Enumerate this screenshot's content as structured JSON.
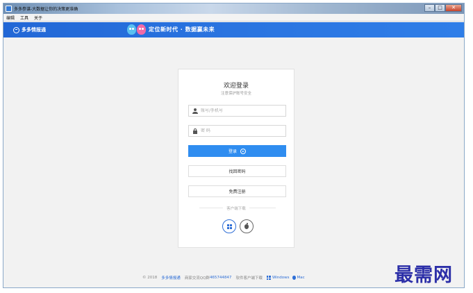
{
  "window": {
    "title": "多多参谋-大数据让你的决策更准确"
  },
  "menu": [
    "编辑",
    "工具",
    "关于"
  ],
  "header": {
    "brand": "多多情报通",
    "slogan": "定位新时代 · 数据赢未来"
  },
  "login": {
    "title": "欢迎登录",
    "subtitle": "注意保护账号安全",
    "username_placeholder": "账号/手机号",
    "password_placeholder": "密 码",
    "login_button": "登录",
    "find_password_button": "找回密码",
    "register_button": "免费注册",
    "download_label": "客户端下载"
  },
  "footer": {
    "copyright": "© 2018",
    "brand": "多多情报通",
    "qq_label": "商家交流QQ群",
    "qq_number": "465744847",
    "download_label": "软件客户端下载",
    "windows": "Windows",
    "mac": "Mac"
  },
  "watermark": "最需网",
  "colors": {
    "accent": "#2f8df0",
    "header": "#2a74e0",
    "watermark": "#2c2fa8"
  },
  "icons": [
    "app-icon",
    "brand-icon",
    "user-icon",
    "lock-icon",
    "arrow-circle-icon",
    "windows-icon",
    "apple-icon"
  ]
}
